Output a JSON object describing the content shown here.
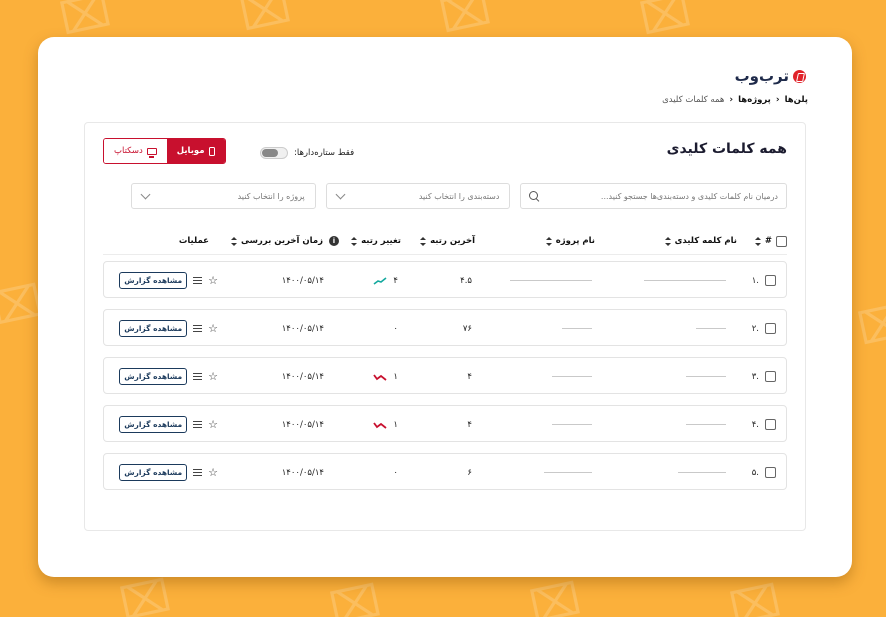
{
  "brand": {
    "name": "ترب‌وب"
  },
  "breadcrumb": {
    "items": [
      "پلن‌ها",
      "پروژه‌ها",
      "همه کلمات کلیدی"
    ]
  },
  "page": {
    "title": "همه کلمات کلیدی",
    "stars_only_label": "فقط ستاره‌دارها:",
    "device": {
      "mobile": "موبایل",
      "desktop": "دسکتاپ",
      "selected": "mobile"
    }
  },
  "filters": {
    "search_placeholder": "درمیان نام کلمات کلیدی و دسته‌بندی‌ها جستجو کنید...",
    "category_placeholder": "دسته‌بندی را انتخاب کنید",
    "project_placeholder": "پروژه را انتخاب کنید"
  },
  "table": {
    "headers": {
      "number": "#",
      "keyword": "نام کلمه کلیدی",
      "project": "نام پروژه",
      "last_rank": "آخرین رتبه",
      "rank_change": "تغییر رتبه",
      "last_check": "زمان آخرین بررسی",
      "actions": "عملیات"
    },
    "rows": [
      {
        "index": ".۱",
        "last_rank": "۴.۵",
        "change": "۴",
        "trend": "up",
        "date": "۱۴۰۰/۰۵/۱۴",
        "report": "مشاهده گزارش"
      },
      {
        "index": ".۲",
        "last_rank": "۷۶",
        "change": "۰",
        "trend": "none",
        "date": "۱۴۰۰/۰۵/۱۴",
        "report": "مشاهده گزارش"
      },
      {
        "index": ".۳",
        "last_rank": "۴",
        "change": "۱",
        "trend": "down",
        "date": "۱۴۰۰/۰۵/۱۴",
        "report": "مشاهده گزارش"
      },
      {
        "index": ".۴",
        "last_rank": "۴",
        "change": "۱",
        "trend": "down",
        "date": "۱۴۰۰/۰۵/۱۴",
        "report": "مشاهده گزارش"
      },
      {
        "index": ".۵",
        "last_rank": "۶",
        "change": "۰",
        "trend": "none",
        "date": "۱۴۰۰/۰۵/۱۴",
        "report": "مشاهده گزارش"
      }
    ]
  },
  "colors": {
    "background": "#fbb03b",
    "accent": "#c8102e",
    "trend_up": "#13a89e",
    "trend_down": "#c8102e"
  }
}
